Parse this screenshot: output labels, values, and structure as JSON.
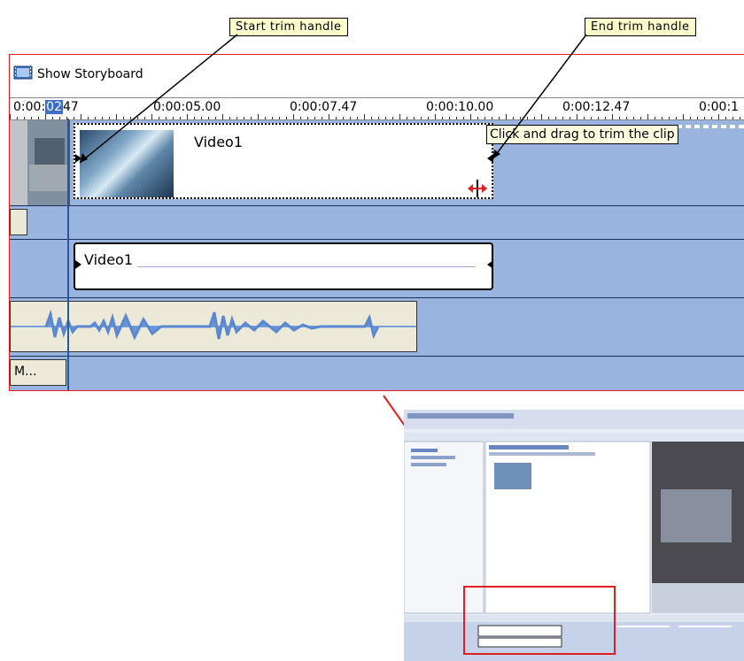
{
  "callouts": {
    "start": "Start trim handle",
    "end": "End trim handle"
  },
  "toolbar": {
    "storyboard_label": "Show Storyboard"
  },
  "ruler": {
    "current": "0:00:",
    "highlight": "02",
    "current_rest": "47",
    "ticks": [
      "0:00:05.00",
      "0:00:07.47",
      "0:00:10.00",
      "0:00:12.47",
      "0:00:1"
    ]
  },
  "tracks": {
    "video_clip_name": "Video1",
    "audio_clip_name": "Video1",
    "music_label": "M..."
  },
  "tooltip": "Click and drag to trim the clip",
  "colors": {
    "timeline_bg": "#9ab4e0",
    "frame_border": "#e02020",
    "callout_bg": "#ffffcc",
    "tooltip_bg": "#ffffe1"
  }
}
